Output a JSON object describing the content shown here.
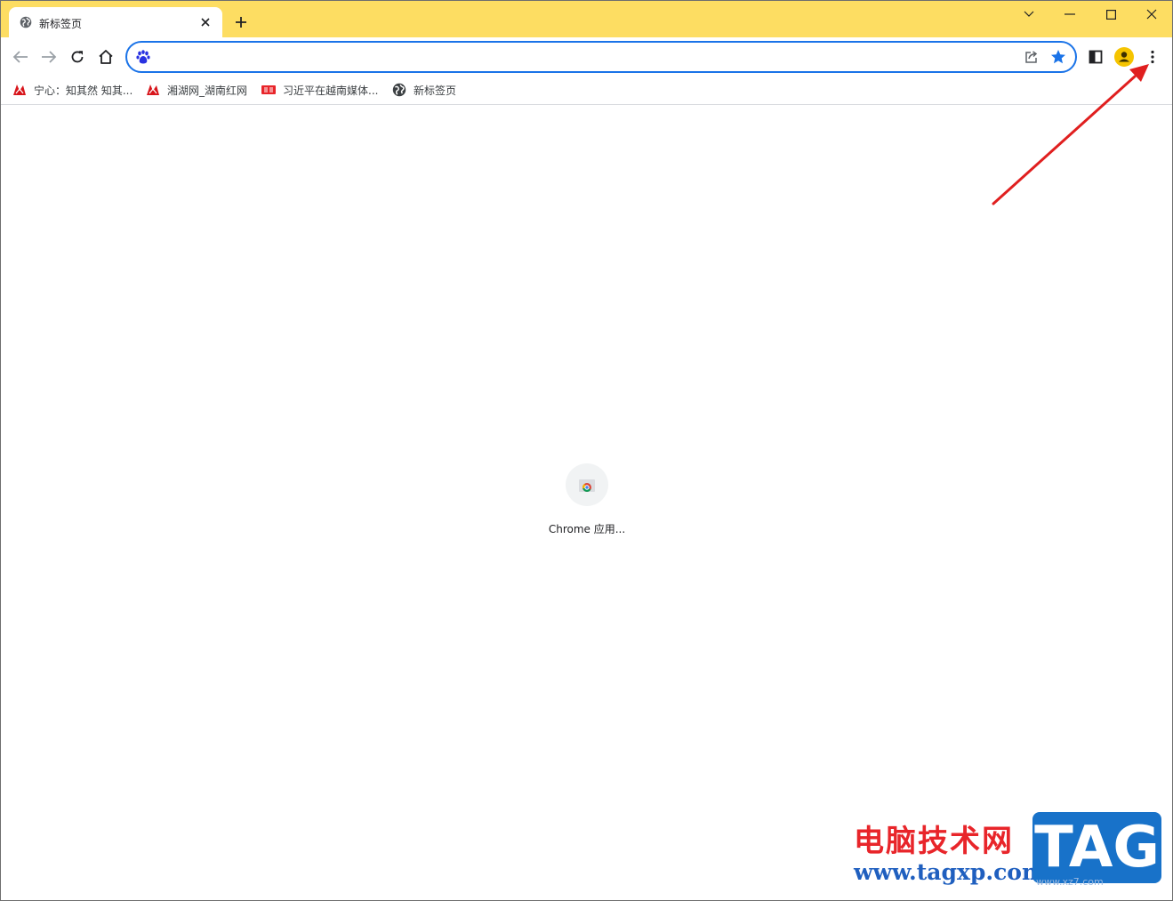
{
  "tab": {
    "title": "新标签页"
  },
  "omnibox": {
    "value": "",
    "placeholder": ""
  },
  "bookmarks": [
    {
      "label": "宁心：知其然 知其..."
    },
    {
      "label": "湘湖网_湖南红网"
    },
    {
      "label": "习近平在越南媒体..."
    },
    {
      "label": "新标签页"
    }
  ],
  "shortcut": {
    "label": "Chrome 应用..."
  },
  "watermark": {
    "cn": "电脑技术网",
    "url": "www.tagxp.com",
    "tag": "TAG",
    "sub": "www.xz7.com"
  },
  "colors": {
    "titlebar": "#fddd62",
    "omnibox_border": "#1a73e8",
    "star": "#1a73e8",
    "avatar": "#f5c400",
    "annotation_arrow": "#e01f1f"
  }
}
